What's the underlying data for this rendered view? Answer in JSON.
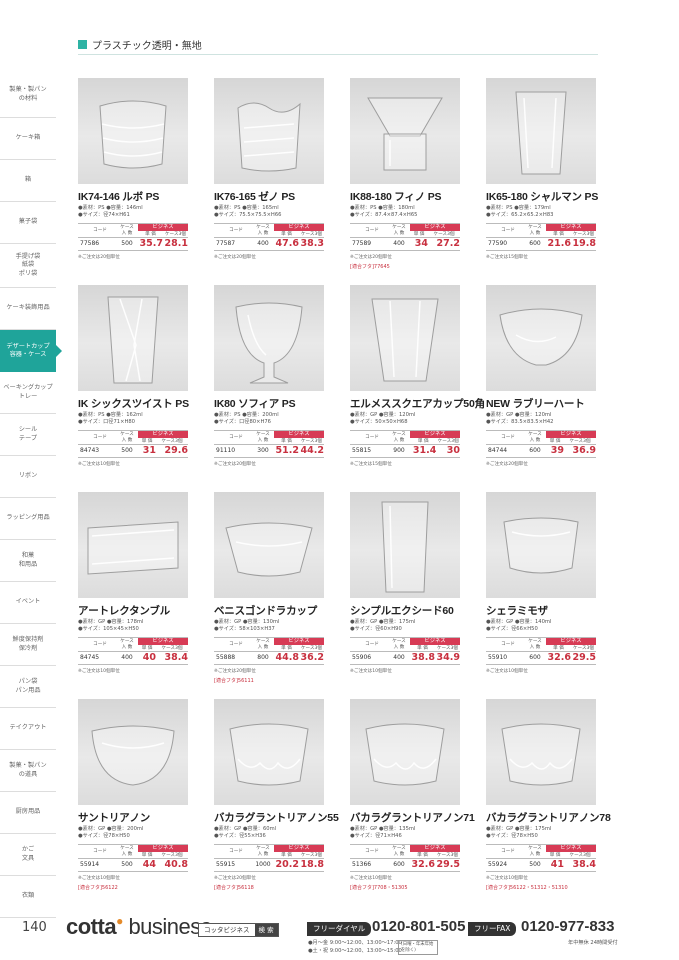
{
  "section": {
    "title": "プラスチック透明・無地"
  },
  "sidebar": {
    "items": [
      {
        "label": "製菓・製パン\nの材料",
        "height": 46,
        "active": false
      },
      {
        "label": "ケーキ箱",
        "height": 42,
        "active": false
      },
      {
        "label": "箱",
        "height": 42,
        "active": false
      },
      {
        "label": "菓子袋",
        "height": 42,
        "active": false
      },
      {
        "label": "手提げ袋\n紙袋\nポリ袋",
        "height": 44,
        "active": false
      },
      {
        "label": "ケーキ装飾用品",
        "height": 42,
        "active": false
      },
      {
        "label": "デザートカップ\n容器・ケース",
        "height": 42,
        "active": true
      },
      {
        "label": "ベーキングカップ\nトレー",
        "height": 42,
        "active": false
      },
      {
        "label": "シール\nテープ",
        "height": 42,
        "active": false
      },
      {
        "label": "リボン",
        "height": 42,
        "active": false
      },
      {
        "label": "ラッピング用品",
        "height": 42,
        "active": false
      },
      {
        "label": "和菓\n和用品",
        "height": 42,
        "active": false
      },
      {
        "label": "イベント",
        "height": 42,
        "active": false
      },
      {
        "label": "鮮度保持剤\n保冷剤",
        "height": 42,
        "active": false
      },
      {
        "label": "パン袋\nパン用品",
        "height": 42,
        "active": false
      },
      {
        "label": "テイクアウト",
        "height": 42,
        "active": false
      },
      {
        "label": "製菓・製パン\nの道具",
        "height": 42,
        "active": false
      },
      {
        "label": "厨房用品",
        "height": 42,
        "active": false
      },
      {
        "label": "かご\n文具",
        "height": 42,
        "active": false
      },
      {
        "label": "衣類",
        "height": 42,
        "active": false
      }
    ]
  },
  "table_labels": {
    "code": "コード",
    "case_qty": "ケース\n入 数",
    "business": "ビジネス",
    "unit_price": "単 価",
    "case3": "ケース3個"
  },
  "products": [
    {
      "name": "IK74-146 ルボ PS",
      "spec1": "●素材：PS ●容量：146ml",
      "spec2": "●サイズ：径74×H61",
      "code": "77586",
      "qty": "500",
      "p1": "35.7",
      "p2": "28.1",
      "note": "※ご注文は20個単位",
      "compat": "",
      "shape": "ribbed"
    },
    {
      "name": "IK76-165 ゼノ PS",
      "spec1": "●素材：PS ●容量：165ml",
      "spec2": "●サイズ：75.5×75.5×H66",
      "code": "77587",
      "qty": "400",
      "p1": "47.6",
      "p2": "38.3",
      "note": "※ご注文は20個単位",
      "compat": "",
      "shape": "wave"
    },
    {
      "name": "IK88-180 フィノ PS",
      "spec1": "●素材：PS ●容量：180ml",
      "spec2": "●サイズ：87.4×87.4×H65",
      "code": "77589",
      "qty": "400",
      "p1": "34",
      "p2": "27.2",
      "note": "※ご注文は20個単位",
      "compat": "[適合フタ]77645",
      "shape": "square"
    },
    {
      "name": "IK65-180 シャルマン PS",
      "spec1": "●素材：PS ●容量：179ml",
      "spec2": "●サイズ：65.2×65.2×H83",
      "code": "77590",
      "qty": "600",
      "p1": "21.6",
      "p2": "19.8",
      "note": "※ご注文は15個単位",
      "compat": "",
      "shape": "tumbler"
    },
    {
      "name": "IK シックスツイスト PS",
      "spec1": "●素材：PS ●容量：162ml",
      "spec2": "●サイズ：口径71×H80",
      "code": "84743",
      "qty": "500",
      "p1": "31",
      "p2": "29.6",
      "note": "※ご注文は10個単位",
      "compat": "",
      "shape": "hex"
    },
    {
      "name": "IK80 ソフィア PS",
      "spec1": "●素材：PS ●容量：200ml",
      "spec2": "●サイズ：口径80×H76",
      "code": "91110",
      "qty": "300",
      "p1": "51.2",
      "p2": "44.2",
      "note": "※ご注文は20個単位",
      "compat": "",
      "shape": "goblet"
    },
    {
      "name": "エルメススクエアカップ50角",
      "spec1": "●素材：GP ●容量：120ml",
      "spec2": "●サイズ：50×50×H68",
      "code": "55815",
      "qty": "900",
      "p1": "31.4",
      "p2": "30",
      "note": "※ご注文は15個単位",
      "compat": "",
      "shape": "squaretall"
    },
    {
      "name": "NEW ラブリーハート",
      "spec1": "●素材：GP ●容量：120ml",
      "spec2": "●サイズ：83.5×83.5×H42",
      "code": "84744",
      "qty": "600",
      "p1": "39",
      "p2": "36.9",
      "note": "※ご注文は20個単位",
      "compat": "",
      "shape": "heart"
    },
    {
      "name": "アートレクタンブル",
      "spec1": "●素材：GP ●容量：178ml",
      "spec2": "●サイズ：105×45×H50",
      "code": "84745",
      "qty": "400",
      "p1": "40",
      "p2": "38.4",
      "note": "※ご注文は10個単位",
      "compat": "",
      "shape": "rect"
    },
    {
      "name": "ベニスゴンドラカップ",
      "spec1": "●素材：GP ●容量：130ml",
      "spec2": "●サイズ：58×103×H37",
      "code": "55888",
      "qty": "800",
      "p1": "44.8",
      "p2": "36.2",
      "note": "※ご注文は20個単位",
      "compat": "[適合フタ]56111",
      "shape": "gondola"
    },
    {
      "name": "シンプルエクシード60",
      "spec1": "●素材：GP ●容量：175ml",
      "spec2": "●サイズ：径60×H90",
      "code": "55906",
      "qty": "400",
      "p1": "38.8",
      "p2": "34.9",
      "note": "※ご注文は10個単位",
      "compat": "",
      "shape": "tall"
    },
    {
      "name": "シェラミモザ",
      "spec1": "●素材：GP ●容量：140ml",
      "spec2": "●サイズ：径66×H50",
      "code": "55910",
      "qty": "600",
      "p1": "32.6",
      "p2": "29.5",
      "note": "※ご注文は10個単位",
      "compat": "",
      "shape": "bowl"
    },
    {
      "name": "サントリアノン",
      "spec1": "●素材：GP ●容量：200ml",
      "spec2": "●サイズ：径78×H50",
      "code": "55914",
      "qty": "500",
      "p1": "44",
      "p2": "40.8",
      "note": "※ご注文は10個単位",
      "compat": "[適合フタ]56122",
      "shape": "round"
    },
    {
      "name": "バカラグラントリアノン55",
      "spec1": "●素材：GP ●容量：60ml",
      "spec2": "●サイズ：径55×H36",
      "code": "55915",
      "qty": "1000",
      "p1": "20.2",
      "p2": "18.8",
      "note": "※ご注文は20個単位",
      "compat": "[適合フタ]56118",
      "shape": "facet"
    },
    {
      "name": "バカラグラントリアノン71",
      "spec1": "●素材：GP ●容量：135ml",
      "spec2": "●サイズ：径71×H46",
      "code": "51366",
      "qty": "600",
      "p1": "32.6",
      "p2": "29.5",
      "note": "※ご注文は10個単位",
      "compat": "[適合フタ]7708・51305",
      "shape": "facet"
    },
    {
      "name": "バカラグラントリアノン78",
      "spec1": "●素材：GP ●容量：175ml",
      "spec2": "●サイズ：径78×H50",
      "code": "55924",
      "qty": "500",
      "p1": "41",
      "p2": "38.4",
      "note": "※ご注文は10個単位",
      "compat": "[適合フタ]56122・51312・51310",
      "shape": "facet"
    }
  ],
  "footer": {
    "page": "140",
    "logo_cotta": "cotta",
    "logo_business": "business",
    "search_term": "コッタビジネス",
    "search_button": "検 索",
    "freedial_label": "フリーダイヤル",
    "freedial_number": "0120-801-505",
    "hours_weekday": "●月～金 9:00～12:00、13:00～17:00",
    "hours_weekend": "●土・祝 9:00～12:00、13:00～15:00",
    "hours_note": "(日曜・年末年始を除く)",
    "fax_label": "フリーFAX",
    "fax_number": "0120-977-833",
    "fax_note": "年中無休 24時間受付"
  }
}
